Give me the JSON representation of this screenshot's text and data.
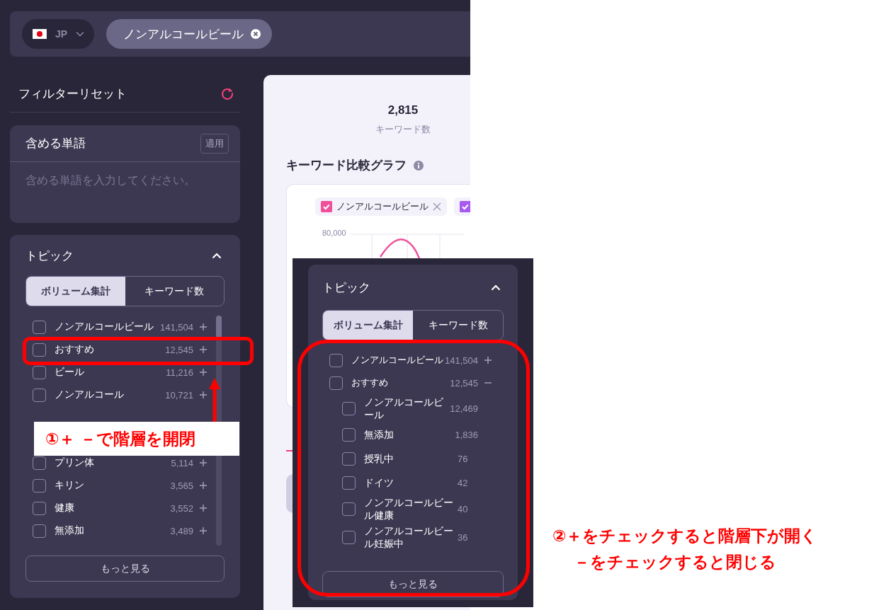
{
  "header": {
    "country": {
      "code": "JP"
    },
    "search_chip": {
      "label": "ノンアルコールビール"
    }
  },
  "sidebar": {
    "reset_label": "フィルターリセット",
    "include_words": {
      "title": "含める単語",
      "apply": "適用",
      "placeholder": "含める単語を入力してください。"
    },
    "topic": {
      "title": "トピック",
      "expanded": true,
      "tabs": [
        {
          "label": "ボリューム集計",
          "selected": true
        },
        {
          "label": "キーワード数",
          "selected": false
        }
      ],
      "items": [
        {
          "label": "ノンアルコールビール",
          "count": "141,504",
          "checked": false,
          "expanded": false
        },
        {
          "label": "おすすめ",
          "count": "12,545",
          "checked": false,
          "expanded": false
        },
        {
          "label": "ビール",
          "count": "11,216",
          "checked": false,
          "expanded": false
        },
        {
          "label": "ノンアルコール",
          "count": "10,721",
          "checked": false,
          "expanded": false
        },
        {
          "label": "プリン体",
          "count": "5,114",
          "checked": false,
          "expanded": false
        },
        {
          "label": "キリン",
          "count": "3,565",
          "checked": false,
          "expanded": false
        },
        {
          "label": "健康",
          "count": "3,552",
          "checked": false,
          "expanded": false
        },
        {
          "label": "無添加",
          "count": "3,489",
          "checked": false,
          "expanded": false
        }
      ],
      "more": "もっと見る"
    }
  },
  "main": {
    "stat": {
      "value": "2,815",
      "label": "キーワード数"
    },
    "graph_title": "キーワード比較グラフ",
    "legend": [
      {
        "label": "ノンアルコールビール",
        "checked": true,
        "color": "#f0509a"
      },
      {
        "checked": true,
        "color": "#a85af0"
      }
    ],
    "y_tick": "80,000"
  },
  "inset_topic": {
    "title": "トピック",
    "expanded": true,
    "tabs": [
      {
        "label": "ボリューム集計",
        "selected": true
      },
      {
        "label": "キーワード数",
        "selected": false
      }
    ],
    "items": [
      {
        "label": "ノンアルコールビール",
        "count": "141,504",
        "checked": false,
        "expanded": false
      },
      {
        "label": "おすすめ",
        "count": "12,545",
        "checked": false,
        "expanded": true,
        "children": [
          {
            "label": "ノンアルコールビール",
            "count": "12,469",
            "checked": false
          },
          {
            "label": "無添加",
            "count": "1,836",
            "checked": false
          },
          {
            "label": "授乳中",
            "count": "76",
            "checked": false
          },
          {
            "label": "ドイツ",
            "count": "42",
            "checked": false
          },
          {
            "label": "ノンアルコールビール健康",
            "count": "40",
            "checked": false
          },
          {
            "label": "ノンアルコールビール妊娠中",
            "count": "36",
            "checked": false
          }
        ]
      }
    ],
    "more": "もっと見る"
  },
  "annotations": [
    {
      "lines": [
        "①＋ －で階層を開閉"
      ]
    },
    {
      "lines": [
        "②＋をチェックすると階層下が開く",
        "－をチェックすると閉じる"
      ]
    }
  ]
}
